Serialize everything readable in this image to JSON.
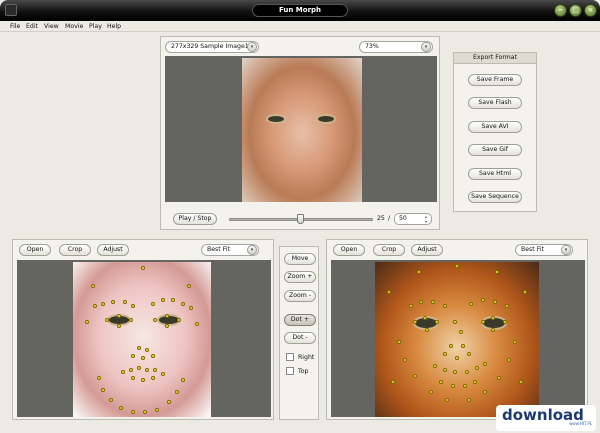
{
  "window": {
    "title": "Fun Morph",
    "minimize_glyph": "−",
    "maximize_glyph": "□",
    "close_glyph": "×"
  },
  "menu": [
    "File",
    "Edit",
    "View",
    "Movie",
    "Play",
    "Help"
  ],
  "preview": {
    "image_select": "277x329 Sample Image1",
    "zoom_select": "73%",
    "play_stop": "Play / Stop",
    "frame_current": "25",
    "frame_separator": "/",
    "frame_total": "50",
    "slider_position": 0.5
  },
  "export": {
    "title": "Export Format",
    "buttons": [
      "Save Frame",
      "Save Flash",
      "Save AVI",
      "Save Gif",
      "Save Html",
      "Save Sequence"
    ]
  },
  "left_panel": {
    "open": "Open",
    "crop": "Crop",
    "adjust": "Adjust",
    "fit_select": "Best Fit"
  },
  "right_panel": {
    "open": "Open",
    "crop": "Crop",
    "adjust": "Adjust",
    "fit_select": "Best Fit"
  },
  "tools": {
    "move": "Move",
    "zoom_in": "Zoom +",
    "zoom_out": "Zoom -",
    "dot_add": "Dot +",
    "dot_remove": "Dot -",
    "right_label": "Right",
    "top_label": "Top"
  },
  "watermark": {
    "text": "download",
    "small": "www.HIT.PL"
  },
  "colors": {
    "title_bar": "#000000",
    "window_controls": "#6d8f33",
    "panel_background": "#f3f2ec",
    "viewport": "#646460",
    "dot": "#ffe320"
  },
  "icons": {
    "combo_arrow": "▾",
    "spin_up": "▴",
    "spin_down": "▾"
  }
}
